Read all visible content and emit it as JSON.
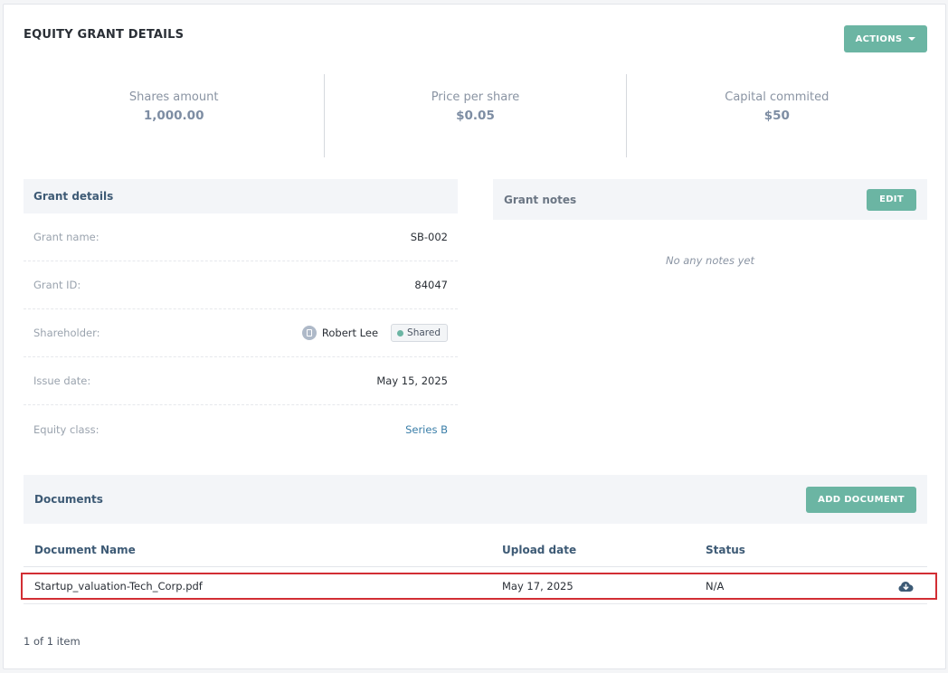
{
  "page": {
    "title": "EQUITY GRANT DETAILS",
    "actions_label": "ACTIONS"
  },
  "stats": [
    {
      "label": "Shares amount",
      "value": "1,000.00"
    },
    {
      "label": "Price per share",
      "value": "$0.05"
    },
    {
      "label": "Capital commited",
      "value": "$50"
    }
  ],
  "grant_details": {
    "title": "Grant details",
    "rows": {
      "grant_name": {
        "label": "Grant name:",
        "value": "SB-002"
      },
      "grant_id": {
        "label": "Grant ID:",
        "value": "84047"
      },
      "shareholder": {
        "label": "Shareholder:",
        "name": "Robert Lee",
        "badge": "Shared"
      },
      "issue_date": {
        "label": "Issue date:",
        "value": "May 15, 2025"
      },
      "equity_class": {
        "label": "Equity class:",
        "value": "Series B"
      }
    }
  },
  "grant_notes": {
    "title": "Grant notes",
    "edit_label": "EDIT",
    "empty_text": "No any notes yet"
  },
  "documents": {
    "title": "Documents",
    "add_label": "ADD DOCUMENT",
    "columns": [
      "Document Name",
      "Upload date",
      "Status"
    ],
    "rows": [
      {
        "name": "Startup_valuation-Tech_Corp.pdf",
        "upload_date": "May 17, 2025",
        "status": "N/A",
        "action_icon": "cloud-download-icon"
      }
    ]
  },
  "pagination": {
    "text": "1 of 1 item"
  },
  "colors": {
    "accent": "#6bb5a3",
    "heading": "#3d5a75",
    "highlight": "#d22e34",
    "link": "#3a7ea8"
  }
}
